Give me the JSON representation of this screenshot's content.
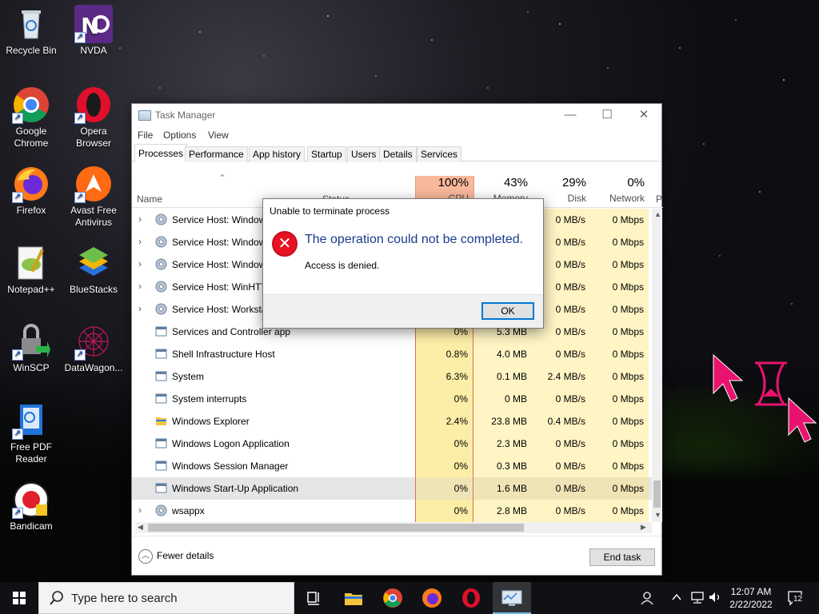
{
  "desktop": {
    "icons": [
      {
        "label": "Recycle Bin",
        "icon": "recycle-bin-icon"
      },
      {
        "label": "NVDA",
        "icon": "nvda-icon"
      },
      {
        "label": "Google Chrome",
        "icon": "chrome-icon"
      },
      {
        "label": "Opera Browser",
        "icon": "opera-icon"
      },
      {
        "label": "Firefox",
        "icon": "firefox-icon"
      },
      {
        "label": "Avast Free Antivirus",
        "icon": "avast-icon"
      },
      {
        "label": "Notepad++",
        "icon": "notepadpp-icon"
      },
      {
        "label": "BlueStacks",
        "icon": "bluestacks-icon"
      },
      {
        "label": "WinSCP",
        "icon": "winscp-icon"
      },
      {
        "label": "DataWagon...",
        "icon": "datawagon-icon"
      },
      {
        "label": "Free PDF Reader",
        "icon": "pdf-reader-icon"
      },
      {
        "label": "Bandicam",
        "icon": "bandicam-icon"
      }
    ]
  },
  "task_manager": {
    "title": "Task Manager",
    "menu": [
      "File",
      "Options",
      "View"
    ],
    "tabs": [
      "Processes",
      "Performance",
      "App history",
      "Startup",
      "Users",
      "Details",
      "Services"
    ],
    "active_tab": "Processes",
    "columns": {
      "name": "Name",
      "status": "Status",
      "cpu": {
        "pct": "100%",
        "label": "CPU"
      },
      "memory": {
        "pct": "43%",
        "label": "Memory"
      },
      "disk": {
        "pct": "29%",
        "label": "Disk"
      },
      "network": {
        "pct": "0%",
        "label": "Network"
      },
      "power": "P"
    },
    "processes": [
      {
        "name": "Service Host: Windows ...",
        "cpu": "",
        "mem": "",
        "disk": "0 MB/s",
        "net": "0 Mbps",
        "expandable": true,
        "icon": "gear-icon"
      },
      {
        "name": "Service Host: Windows ...",
        "cpu": "",
        "mem": "",
        "disk": "0 MB/s",
        "net": "0 Mbps",
        "expandable": true,
        "icon": "gear-icon"
      },
      {
        "name": "Service Host: Windows ...",
        "cpu": "",
        "mem": "",
        "disk": "0 MB/s",
        "net": "0 Mbps",
        "expandable": true,
        "icon": "gear-icon"
      },
      {
        "name": "Service Host: WinHTTP ...",
        "cpu": "",
        "mem": "",
        "disk": "0 MB/s",
        "net": "0 Mbps",
        "expandable": true,
        "icon": "gear-icon"
      },
      {
        "name": "Service Host: Workstation",
        "cpu": "",
        "mem": "",
        "disk": "0 MB/s",
        "net": "0 Mbps",
        "expandable": true,
        "icon": "gear-icon"
      },
      {
        "name": "Services and Controller app",
        "cpu": "0%",
        "mem": "5.3 MB",
        "disk": "0 MB/s",
        "net": "0 Mbps",
        "expandable": false,
        "icon": "app-icon"
      },
      {
        "name": "Shell Infrastructure Host",
        "cpu": "0.8%",
        "mem": "4.0 MB",
        "disk": "0 MB/s",
        "net": "0 Mbps",
        "expandable": false,
        "icon": "app-icon"
      },
      {
        "name": "System",
        "cpu": "6.3%",
        "mem": "0.1 MB",
        "disk": "2.4 MB/s",
        "net": "0 Mbps",
        "expandable": false,
        "icon": "app-icon"
      },
      {
        "name": "System interrupts",
        "cpu": "0%",
        "mem": "0 MB",
        "disk": "0 MB/s",
        "net": "0 Mbps",
        "expandable": false,
        "icon": "app-icon"
      },
      {
        "name": "Windows Explorer",
        "cpu": "2.4%",
        "mem": "23.8 MB",
        "disk": "0.4 MB/s",
        "net": "0 Mbps",
        "expandable": false,
        "icon": "folder-icon"
      },
      {
        "name": "Windows Logon Application",
        "cpu": "0%",
        "mem": "2.3 MB",
        "disk": "0 MB/s",
        "net": "0 Mbps",
        "expandable": false,
        "icon": "app-icon"
      },
      {
        "name": "Windows Session Manager",
        "cpu": "0%",
        "mem": "0.3 MB",
        "disk": "0 MB/s",
        "net": "0 Mbps",
        "expandable": false,
        "icon": "app-icon"
      },
      {
        "name": "Windows Start-Up Application",
        "cpu": "0%",
        "mem": "1.6 MB",
        "disk": "0 MB/s",
        "net": "0 Mbps",
        "expandable": false,
        "icon": "app-icon",
        "selected": true
      },
      {
        "name": "wsappx",
        "cpu": "0%",
        "mem": "2.8 MB",
        "disk": "0 MB/s",
        "net": "0 Mbps",
        "expandable": true,
        "icon": "gear-icon"
      }
    ],
    "footer": {
      "fewer_details": "Fewer details",
      "end_task": "End task"
    }
  },
  "dialog": {
    "title": "Unable to terminate process",
    "message": "The operation could not be completed.",
    "detail": "Access is denied.",
    "ok": "OK"
  },
  "taskbar": {
    "search_placeholder": "Type here to search",
    "time": "12:07 AM",
    "date": "2/22/2022",
    "notification_count": "12"
  },
  "colors": {
    "cpu_header": "#f9b99a",
    "cpu_cell": "#fdeea7",
    "cell": "#fff4c4",
    "dialog_heading": "#1b3c8e",
    "error_red": "#e81123",
    "cursor_pink": "#e8136f"
  }
}
